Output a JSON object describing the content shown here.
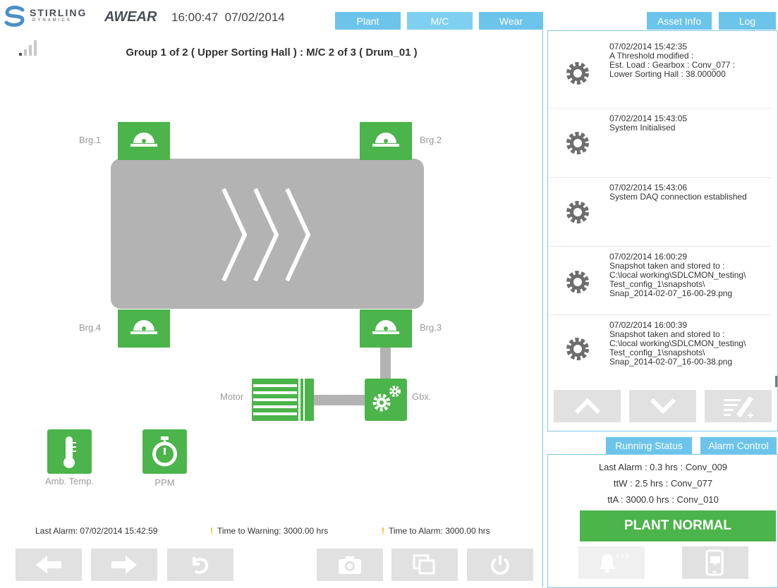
{
  "header": {
    "logo_text": "STIRLING",
    "logo_sub": "DYNAMICS",
    "app_title": "AWEAR",
    "time": "16:00:47",
    "date": "07/02/2014",
    "tabs": [
      {
        "label": "Plant"
      },
      {
        "label": "M/C"
      },
      {
        "label": "Wear"
      },
      {
        "label": "Asset Info"
      },
      {
        "label": "Log"
      }
    ]
  },
  "main": {
    "title": "Group 1 of 2 ( Upper Sorting Hall ) : M/C 2 of 3 ( Drum_01 )",
    "bearings": [
      "Brg.1",
      "Brg.2",
      "Brg.3",
      "Brg.4"
    ],
    "motor_label": "Motor",
    "gearbox_label": "Gbx.",
    "sensors": [
      {
        "label": "Amb. Temp.",
        "icon": "thermometer-icon"
      },
      {
        "label": "PPM",
        "icon": "stopwatch-icon"
      }
    ],
    "status": {
      "last_alarm": "Last Alarm: 07/02/2014 15:42:59",
      "time_to_warning": "Time to Warning: 3000.00 hrs",
      "time_to_alarm": "Time to Alarm: 3000.00 hrs",
      "warn_glyph": "!"
    },
    "nav_icons": [
      "arrow-left-icon",
      "arrow-right-icon",
      "undo-icon",
      "camera-icon",
      "windows-icon",
      "power-icon"
    ]
  },
  "log": {
    "entries": [
      {
        "timestamp": "07/02/2014 15:42:35",
        "text": "A Threshold modified :\nEst. Load : Gearbox : Conv_077 :\nLower Sorting Hall : 38.000000"
      },
      {
        "timestamp": "07/02/2014 15:43:05",
        "text": "System Initialised"
      },
      {
        "timestamp": "07/02/2014 15:43:06",
        "text": "System DAQ connection established"
      },
      {
        "timestamp": "07/02/2014 16:00:29",
        "text": "Snapshot taken and stored to :\nC:\\local working\\SDLCMON_testing\\\nTest_config_1\\snapshots\\\nSnap_2014-02-07_16-00-29.png"
      },
      {
        "timestamp": "07/02/2014 16:00:39",
        "text": "Snapshot taken and stored to :\nC:\\local working\\SDLCMON_testing\\\nTest_config_1\\snapshots\\\nSnap_2014-02-07_16-00-38.png"
      }
    ],
    "controls": [
      "chevron-up-icon",
      "chevron-down-icon",
      "edit-note-icon"
    ]
  },
  "status_panel": {
    "tabs": [
      {
        "label": "Running Status"
      },
      {
        "label": "Alarm Control"
      }
    ],
    "last_alarm": "Last Alarm :  0.3 hrs : Conv_009",
    "ttw": "ttW :  2.5 hrs : Conv_077",
    "tta": "ttA : 3000.0 hrs : Conv_010",
    "plant_state": "PLANT NORMAL",
    "plant_state_color": "#4bb44a",
    "bell_zzz": "z z z",
    "controls": [
      "snooze-bell-icon",
      "mobile-message-icon"
    ]
  },
  "colors": {
    "accent_blue": "#6cc4ea",
    "status_green": "#4bb44a",
    "idle_gray": "#b3b3b3",
    "button_gray": "#e1e1e1"
  }
}
